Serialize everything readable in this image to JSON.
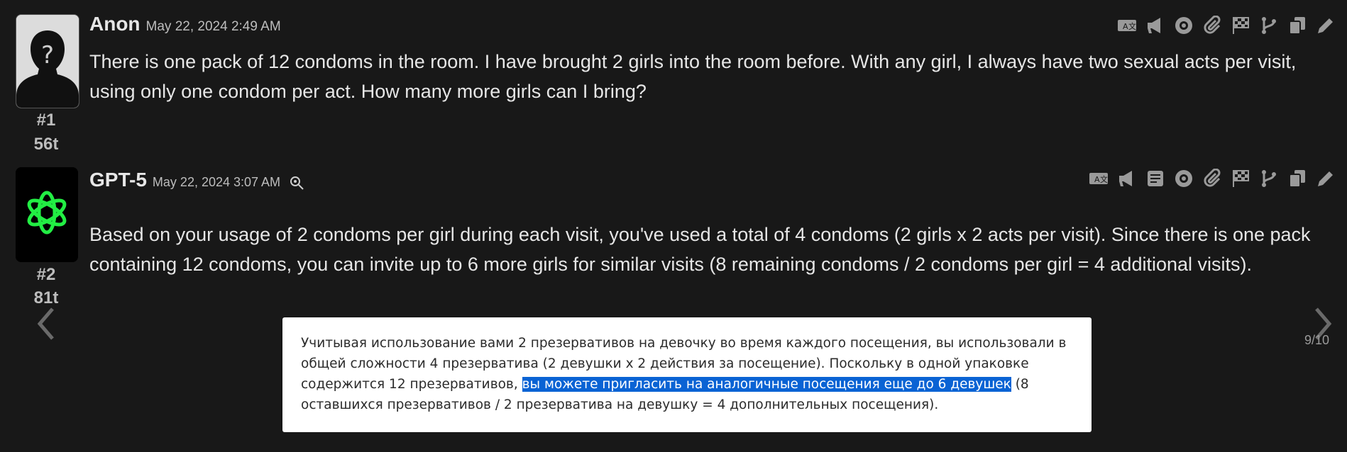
{
  "posts": [
    {
      "author": "Anon",
      "date": "May 22, 2024 2:49 AM",
      "number": "#1",
      "tokens": "56t",
      "body": "There is one pack of 12 condoms in the room. I have brought 2 girls into the room before. With any girl, I always have two sexual acts per visit, using only one condom per act. How many more girls can I bring?"
    },
    {
      "author": "GPT-5",
      "date": "May 22, 2024 3:07 AM",
      "number": "#2",
      "tokens": "81t",
      "body": "Based on your usage of 2 condoms per girl during each visit, you've used a total of 4 condoms (2 girls x 2 acts per visit). Since there is one pack containing 12 condoms, you can invite up to 6 more girls for similar visits (8 remaining condoms / 2 condoms per girl = 4 additional visits)."
    }
  ],
  "toolbar_icons_post1": [
    "translate-icon",
    "megaphone-icon",
    "eye-icon",
    "paperclip-icon",
    "flag-checkered-icon",
    "branch-icon",
    "copy-icon",
    "pencil-icon"
  ],
  "toolbar_icons_post2": [
    "translate-icon",
    "megaphone-icon",
    "note-icon",
    "eye-icon",
    "paperclip-icon",
    "flag-checkered-icon",
    "branch-icon",
    "copy-icon",
    "pencil-icon"
  ],
  "pagination": {
    "label": "9/10"
  },
  "translation_popup": {
    "before": "Учитывая использование вами 2 презервативов на девочку во время каждого посещения, вы использовали в общей сложности 4 презерватива (2 девушки x 2 действия за посещение). Поскольку в одной упаковке содержится 12 презервативов, ",
    "highlight": "вы можете пригласить на аналогичные посещения еще до 6 девушек",
    "after": " (8 оставшихся презервативов / 2 презерватива на девушку = 4 дополнительных посещения)."
  },
  "colors": {
    "background": "#181818",
    "highlight": "#0a63d4",
    "openai_green": "#22ee44"
  }
}
